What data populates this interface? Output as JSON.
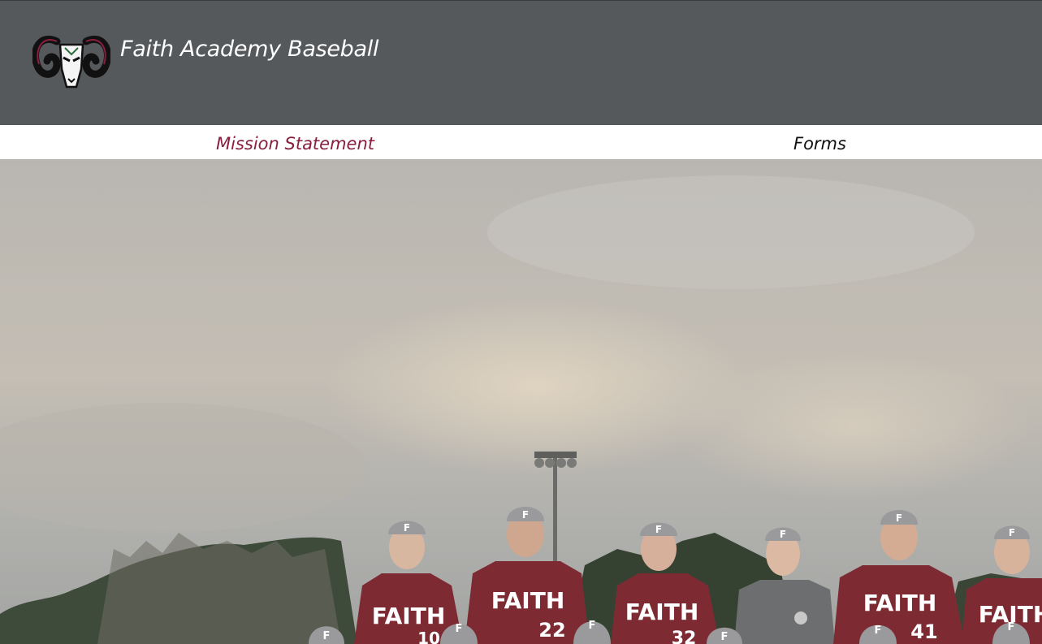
{
  "header": {
    "title": "Faith Academy Baseball",
    "logo_icon": "ram-head-icon",
    "background_color": "#55595c"
  },
  "nav": {
    "items": [
      {
        "label": "Mission Statement",
        "color": "#8a1e3e"
      },
      {
        "label": "Forms",
        "color": "#111111"
      }
    ]
  },
  "hero": {
    "jersey_text": "FAITH",
    "cap_letter": "F",
    "numbers": [
      "10",
      "22",
      "32",
      "41"
    ]
  },
  "colors": {
    "accent": "#8a1e3e",
    "jersey": "#7e2a33",
    "cap": "#9a9a9c"
  }
}
